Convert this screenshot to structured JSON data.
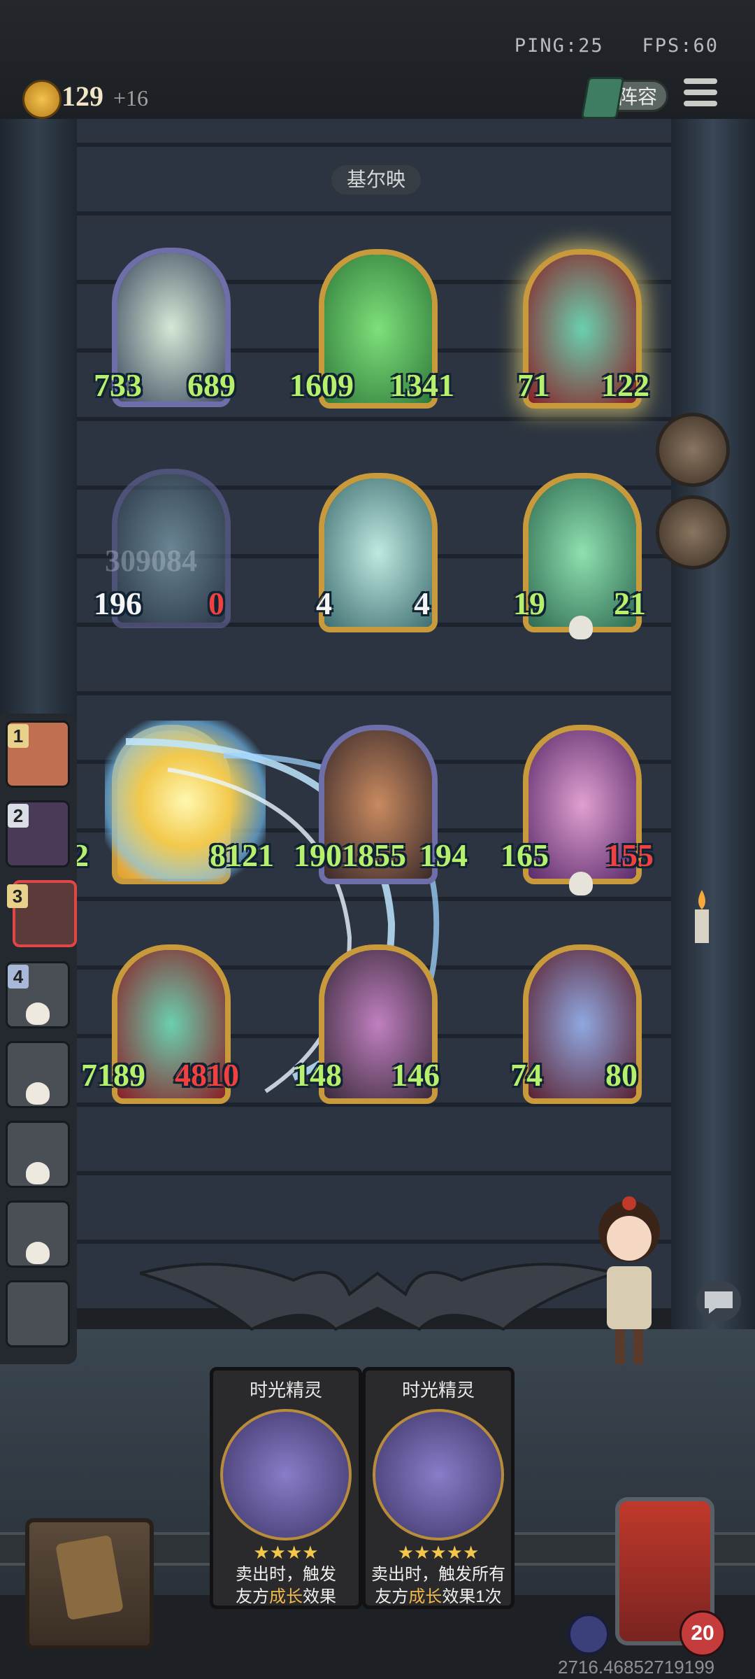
{
  "hud": {
    "ping": "PING:25",
    "fps": "FPS:60",
    "gold": "129",
    "gold_income": "+16",
    "lineup_label": "阵容"
  },
  "enemy": {
    "name": "基尔映"
  },
  "board": {
    "row1": [
      {
        "name": "flower-maiden",
        "atk": "733",
        "hp": "689"
      },
      {
        "name": "green-bandit",
        "atk": "1609",
        "hp": "1341"
      },
      {
        "name": "ghost-chef",
        "atk": "71",
        "hp": "122"
      }
    ],
    "row2": [
      {
        "name": "spectral-beast",
        "atk": "196",
        "hp": "0",
        "ghost": "309084"
      },
      {
        "name": "skeleton-ghoul",
        "atk": "4",
        "hp": "4"
      },
      {
        "name": "bearded-wizard",
        "atk": "19",
        "hp": "21"
      }
    ],
    "row3": [
      {
        "name": "attacking-unit",
        "atk": "2",
        "hp": "8121"
      },
      {
        "name": "hooded-rogue",
        "atk": "1901855",
        "hp": "194"
      },
      {
        "name": "sorceress",
        "atk": "165",
        "hp": "155"
      }
    ],
    "row4": [
      {
        "name": "ghost-chef-ally",
        "atk": "7189",
        "hp": "4810"
      },
      {
        "name": "shadow-assassin",
        "atk": "148",
        "hp": "146"
      },
      {
        "name": "elf-queen",
        "atk": "74",
        "hp": "80"
      }
    ]
  },
  "queue": [
    {
      "num": "1"
    },
    {
      "num": "2"
    },
    {
      "num": "3"
    },
    {
      "num": "4"
    },
    {
      "num": ""
    },
    {
      "num": ""
    },
    {
      "num": ""
    },
    {
      "num": ""
    }
  ],
  "shop": [
    {
      "title": "时光精灵",
      "stars": "★★★★",
      "desc_pre": "卖出时，触发",
      "desc_hl": "成长",
      "desc_line1": "卖出时，触发",
      "desc_line2_pre": "友方",
      "desc_line2_post": "效果"
    },
    {
      "title": "时光精灵",
      "stars": "★★★★★",
      "desc_line1": "卖出时，触发所有",
      "desc_line2_pre": "友方",
      "desc_hl": "成长",
      "desc_line2_post": "效果1次"
    }
  ],
  "player": {
    "hp": "20"
  },
  "coords": "2716.46852719199",
  "colors": {
    "atk": "#b6f06c",
    "hp_low": "#f04040",
    "gold": "#f3c24e",
    "accent_card": "#c99a3c"
  }
}
